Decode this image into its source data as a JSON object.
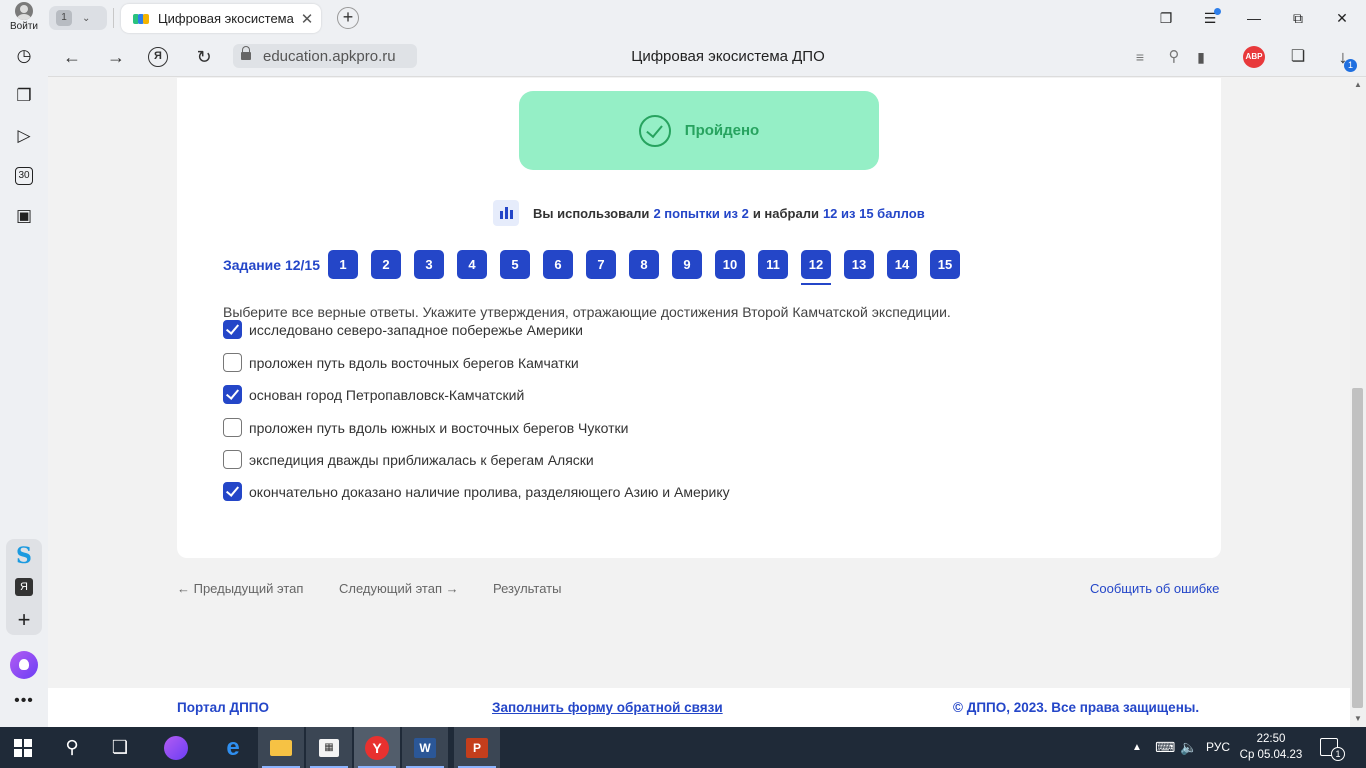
{
  "browser": {
    "profile_label": "Войти",
    "tab_group_count": "1",
    "tab_title": "Цифровая экосистема ДПО",
    "url": "education.apkpro.ru",
    "page_title": "Цифровая экосистема ДПО",
    "abp_label": "ABP",
    "download_badge": "1"
  },
  "sidebar": {
    "calendar_day": "30",
    "ya_label": "Я"
  },
  "result": {
    "status": "Пройдено",
    "stats_prefix": "Вы использовали",
    "attempts": "2 попытки из 2",
    "stats_middle": "и набрали",
    "score": "12 из 15 баллов"
  },
  "tasks": {
    "label": "Задание 12/15",
    "numbers": [
      "1",
      "2",
      "3",
      "4",
      "5",
      "6",
      "7",
      "8",
      "9",
      "10",
      "11",
      "12",
      "13",
      "14",
      "15"
    ],
    "active": "12"
  },
  "question": {
    "text": "Выберите все верные ответы. Укажите утверждения, отражающие достижения Второй Камчатской экспедиции.",
    "options": [
      {
        "label": "исследовано северо-западное побережье Америки",
        "checked": true
      },
      {
        "label": "проложен путь вдоль восточных берегов Камчатки",
        "checked": false
      },
      {
        "label": "основан город Петропавловск-Камчатский",
        "checked": true
      },
      {
        "label": "проложен путь вдоль южных и восточных берегов Чукотки",
        "checked": false
      },
      {
        "label": "экспедиция дважды приближалась к берегам Аляски",
        "checked": false
      },
      {
        "label": "окончательно доказано наличие пролива, разделяющего Азию и Америку",
        "checked": true
      }
    ]
  },
  "navigation": {
    "prev": "← Предыдущий этап",
    "next": "Следующий этап →",
    "results": "Результаты",
    "report": "Сообщить об ошибке"
  },
  "footer": {
    "portal": "Портал ДППО",
    "feedback": "Заполнить форму обратной связи",
    "copyright": "© ДППО, 2023. Все права защищены."
  },
  "taskbar": {
    "language": "РУС",
    "time": "22:50",
    "date": "Ср 05.04.23",
    "notifications": "1"
  },
  "colors": {
    "accent": "#2446c8",
    "success_bg": "#95efc6",
    "success_fg": "#27a35f"
  }
}
